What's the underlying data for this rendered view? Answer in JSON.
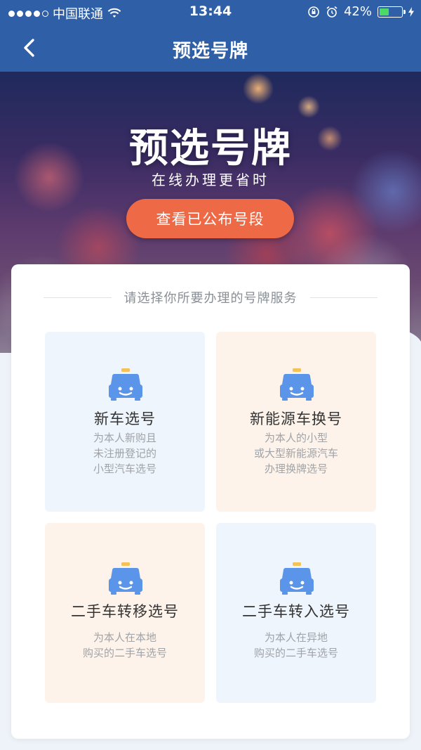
{
  "status_bar": {
    "carrier": "中国联通",
    "time": "13:44",
    "battery": "42%",
    "battery_level": 0.42
  },
  "nav": {
    "title": "预选号牌"
  },
  "hero": {
    "title": "预选号牌",
    "subtitle": "在线办理更省时",
    "button_label": "查看已公布号段"
  },
  "card": {
    "header": "请选择你所要办理的号牌服务",
    "tiles": [
      {
        "title": "新车选号",
        "desc": [
          "为本人新购且",
          "未注册登记的",
          "小型汽车选号"
        ],
        "icon": "taxi-icon",
        "bg": "#eef5fd"
      },
      {
        "title": "新能源车换号",
        "desc": [
          "为本人的小型",
          "或大型新能源汽车",
          "办理换牌选号"
        ],
        "icon": "taxi-icon",
        "bg": "#fdf3ea"
      },
      {
        "title": "二手车转移选号",
        "desc": [
          "为本人在本地",
          "购买的二手车选号"
        ],
        "icon": "taxi-icon",
        "bg": "#fdf3ea"
      },
      {
        "title": "二手车转入选号",
        "desc": [
          "为本人在异地",
          "购买的二手车选号"
        ],
        "icon": "taxi-icon",
        "bg": "#eef5fd"
      }
    ]
  },
  "colors": {
    "nav_bg": "#2f5fa6",
    "accent_button": "#ee6a47",
    "icon_blue": "#5b95ea",
    "icon_roof": "#f5c25a"
  }
}
